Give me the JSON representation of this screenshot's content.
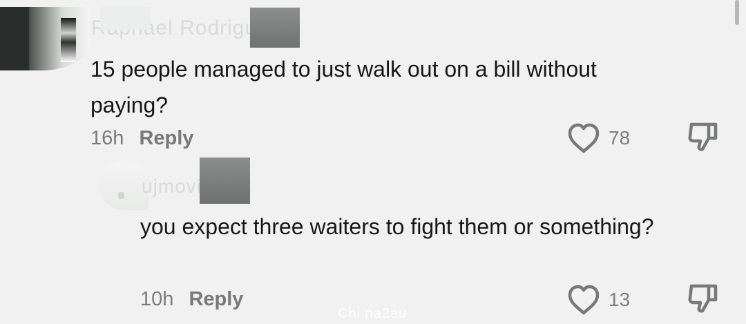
{
  "comment": {
    "username": "Raphael Rodriguez",
    "text": "15 people managed to just walk out on a bill without paying?",
    "time": "16h",
    "reply_label": "Reply",
    "likes": "78"
  },
  "reply": {
    "username": "ujmovi",
    "text": "you expect three waiters to fight them or something?",
    "time": "10h",
    "reply_label": "Reply",
    "likes": "13"
  },
  "watermark": "Chi na2au",
  "icons": {
    "like": "heart-icon",
    "dislike": "thumbs-down-icon"
  }
}
